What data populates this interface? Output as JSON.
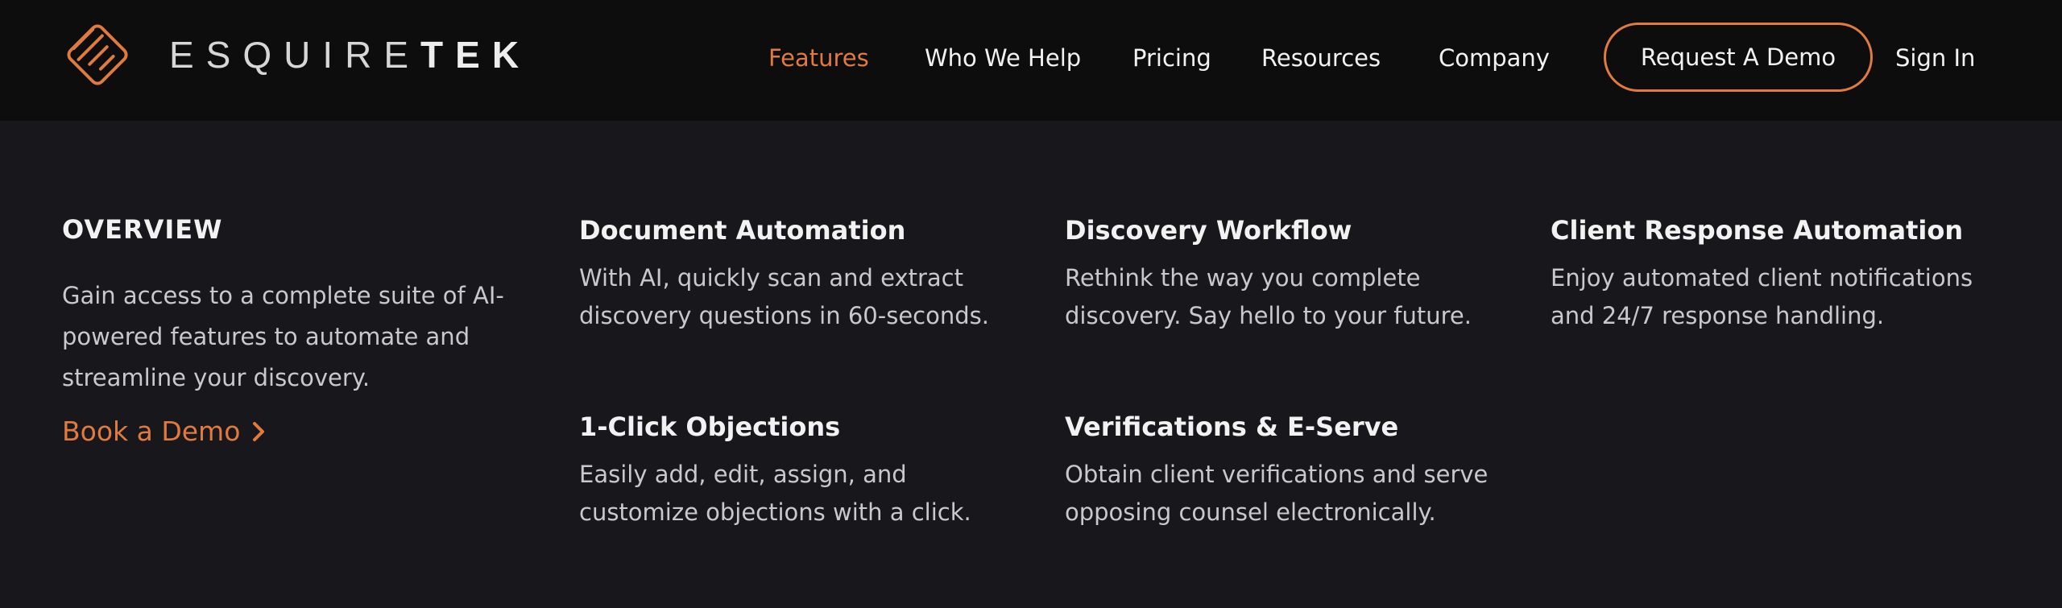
{
  "brand": {
    "name_light": "ESQUIRE",
    "name_bold": "TEK",
    "accent": "#e07a3f"
  },
  "nav": {
    "items": [
      {
        "label": "Features",
        "active": true
      },
      {
        "label": "Who We Help"
      },
      {
        "label": "Pricing"
      },
      {
        "label": "Resources"
      },
      {
        "label": "Company"
      }
    ],
    "cta_label": "Request A Demo",
    "signin_label": "Sign In"
  },
  "menu": {
    "overview": {
      "title": "OVERVIEW",
      "body": "Gain access to a complete suite of AI-powered features to automate and streamline your discovery.",
      "link_label": "Book a Demo",
      "link_icon": "chevron-right-icon"
    },
    "features": [
      {
        "title": "Document Automation",
        "desc": "With AI, quickly scan and extract discovery questions in 60-seconds."
      },
      {
        "title": "Discovery Workflow",
        "desc": "Rethink the way you complete discovery. Say hello to your future."
      },
      {
        "title": "Client Response Automation",
        "desc": "Enjoy automated client notifications and 24/7 response handling."
      },
      {
        "title": "1-Click Objections",
        "desc": "Easily add, edit, assign, and customize objections with a click."
      },
      {
        "title": "Verifications & E-Serve",
        "desc": "Obtain client verifications and serve opposing counsel electronically."
      }
    ]
  }
}
